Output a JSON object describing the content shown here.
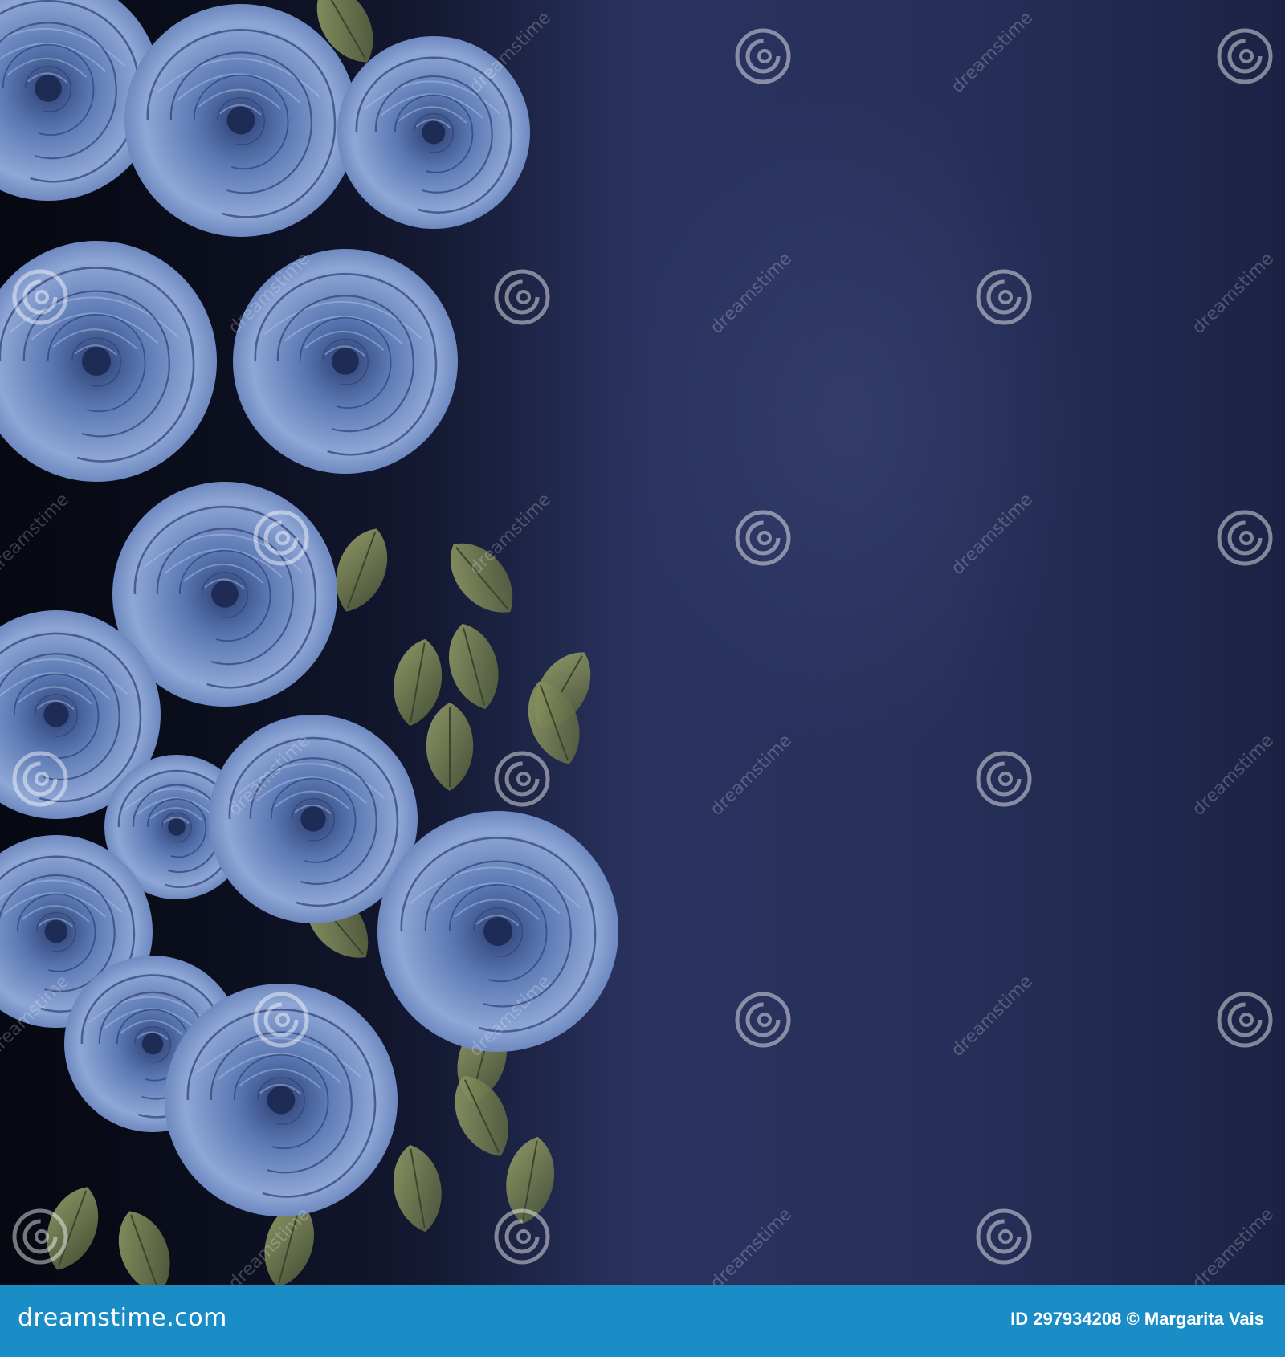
{
  "image": {
    "subject": "blue-roses-on-dark-navy-background",
    "colors": {
      "background": "#1f2a4e",
      "rose_light": "#8fa7d6",
      "rose_mid": "#5b78b3",
      "rose_dark": "#2c3f72",
      "leaf": "#6b7650",
      "footer_bar": "#1b8dc6"
    }
  },
  "watermark": {
    "logo_text": "dreamstime",
    "icon": "spiral-logo-icon"
  },
  "footer": {
    "brand": "dreamstime.com",
    "id_label": "ID",
    "id_value": "297934208",
    "copyright_symbol": "©",
    "author": "Margarita Vais"
  }
}
